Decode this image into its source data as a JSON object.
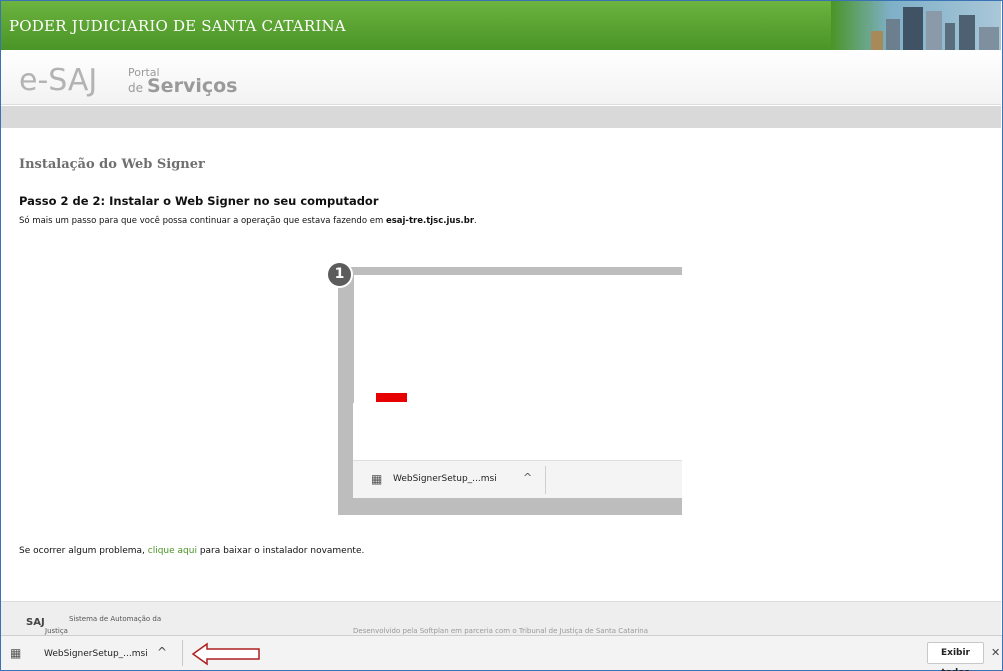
{
  "header": {
    "title": "PODER JUDICIARIO DE SANTA CATARINA"
  },
  "logo": {
    "esaj": "e-SAJ",
    "portal": "Portal",
    "de": "de",
    "servicos": "Serviços"
  },
  "page": {
    "title": "Instalação do Web Signer",
    "step_title": "Passo 2 de 2: Instalar o Web Signer no seu computador",
    "step_desc_prefix": "Só mais um passo para que você possa continuar a operação que estava fazendo em ",
    "step_desc_host": "esaj-tre.tjsc.jus.br",
    "step_desc_suffix": "."
  },
  "illustration": {
    "badge": "1",
    "download_label": "WebSignerSetup_...msi",
    "chevron": "^"
  },
  "problem": {
    "prefix": "Se ocorrer algum problema, ",
    "link": "clique aqui",
    "suffix": " para baixar o instalador novamente."
  },
  "footer": {
    "logo": "SAJ",
    "system": "Sistema de Automação da",
    "justica": "Justiça",
    "developed": "Desenvolvido pela Softplan em parceria com o Tribunal de Justiça de Santa Catarina"
  },
  "download_bar": {
    "file_label": "WebSignerSetup_...msi",
    "chevron": "^",
    "show_all": "Exibir todos",
    "close": "✕"
  },
  "colors": {
    "header_green": "#4a9527",
    "link_green": "#4a9527",
    "arrow_red": "#b02020",
    "highlight_red": "#e60000"
  },
  "icons": {
    "download_file": "msi-file-icon",
    "arrow": "left-arrow-icon",
    "close": "close-icon"
  }
}
